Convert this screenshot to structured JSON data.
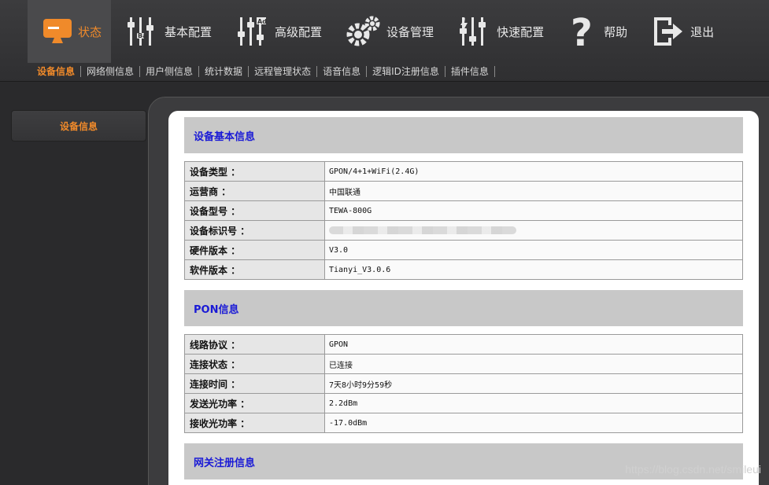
{
  "nav": {
    "items": [
      {
        "label": "状态",
        "icon": "monitor-icon"
      },
      {
        "label": "基本配置",
        "icon": "sliders-basic-icon"
      },
      {
        "label": "高级配置",
        "icon": "sliders-advanced-icon"
      },
      {
        "label": "设备管理",
        "icon": "gears-icon"
      },
      {
        "label": "快速配置",
        "icon": "sliders-quick-icon"
      },
      {
        "label": "帮助",
        "icon": "question-icon"
      },
      {
        "label": "退出",
        "icon": "logout-icon"
      }
    ]
  },
  "subnav": {
    "items": [
      "设备信息",
      "网络侧信息",
      "用户侧信息",
      "统计数据",
      "远程管理状态",
      "语音信息",
      "逻辑ID注册信息",
      "插件信息"
    ]
  },
  "sidebar": {
    "item": "设备信息"
  },
  "sections": {
    "basic": {
      "title": "设备基本信息",
      "rows": [
        {
          "k": "设备类型 ：",
          "v": "GPON/4+1+WiFi(2.4G)"
        },
        {
          "k": "运营商 ：",
          "v": "中国联通"
        },
        {
          "k": "设备型号 ：",
          "v": "TEWA-800G"
        },
        {
          "k": "设备标识号 ：",
          "v": ""
        },
        {
          "k": "硬件版本 ：",
          "v": "V3.0"
        },
        {
          "k": "软件版本 ：",
          "v": "Tianyi_V3.0.6"
        }
      ]
    },
    "pon": {
      "title": "PON信息",
      "rows": [
        {
          "k": "线路协议 ：",
          "v": "GPON"
        },
        {
          "k": "连接状态 ：",
          "v": "已连接"
        },
        {
          "k": "连接时间 ：",
          "v": "7天8小时9分59秒"
        },
        {
          "k": "发送光功率 ：",
          "v": "2.2dBm"
        },
        {
          "k": "接收光功率 ：",
          "v": "-17.0dBm"
        }
      ]
    },
    "gateway": {
      "title": "网关注册信息"
    }
  },
  "watermark": "https://blog.csdn.net/smileui",
  "colors": {
    "accent": "#f08a2a",
    "section_title": "#1a1ad6"
  }
}
